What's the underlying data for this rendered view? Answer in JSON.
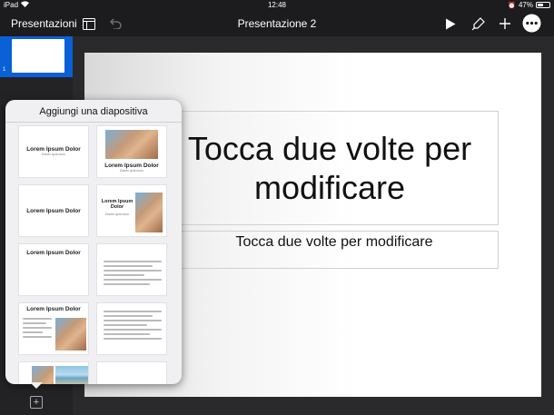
{
  "status_bar": {
    "device": "iPad",
    "time": "12:48",
    "battery": "47%"
  },
  "toolbar": {
    "back_label": "Presentazioni",
    "title": "Presentazione 2"
  },
  "sidebar": {
    "slide_number": "1"
  },
  "slide": {
    "title": "Tocca due volte per modificare",
    "subtitle": "Tocca due volte per modificare"
  },
  "popover": {
    "title": "Aggiungi una diapositiva",
    "layouts": {
      "l1_title": "Lorem Ipsum Dolor",
      "l1_sub": "Donec quis nunc",
      "l2_title": "Lorem Ipsum Dolor",
      "l2_sub": "Donec quis nunc",
      "l3_title": "Lorem Ipsum Dolor",
      "l4_title": "Lorem Ipsum Dolor",
      "l4_sub": "Donec quis nunc",
      "l5_title": "Lorem Ipsum Dolor",
      "l7_title": "Lorem Ipsum Dolor"
    }
  }
}
